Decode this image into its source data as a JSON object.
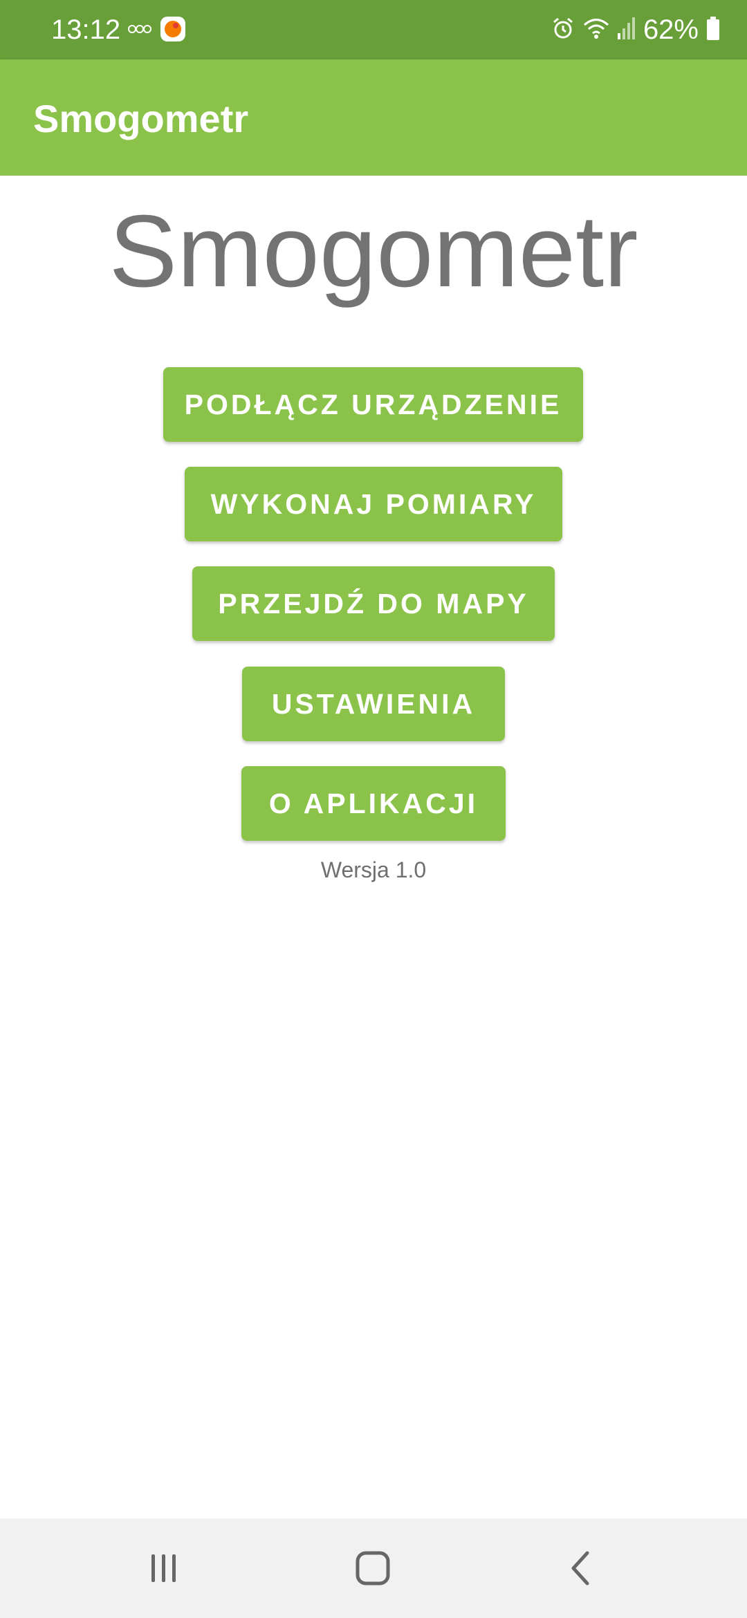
{
  "status_bar": {
    "time": "13:12",
    "battery": "62%",
    "icons": [
      "voicemail-icon",
      "notification-app-icon",
      "alarm-icon",
      "wifi-icon",
      "signal-icon",
      "battery-icon"
    ]
  },
  "app_bar": {
    "title": "Smogometr"
  },
  "main": {
    "heading": "Smogometr",
    "buttons": [
      {
        "label": "PODŁĄCZ URZĄDZENIE"
      },
      {
        "label": "WYKONAJ POMIARY"
      },
      {
        "label": "PRZEJDŹ DO MAPY"
      },
      {
        "label": "USTAWIENIA"
      },
      {
        "label": "O APLIKACJI"
      }
    ],
    "version": "Wersja 1.0"
  },
  "nav_bar": {
    "icons": [
      "recents-icon",
      "home-icon",
      "back-icon"
    ]
  },
  "colors": {
    "status_bar": "#689f38",
    "accent": "#8bc34a",
    "heading_text": "#737373"
  }
}
